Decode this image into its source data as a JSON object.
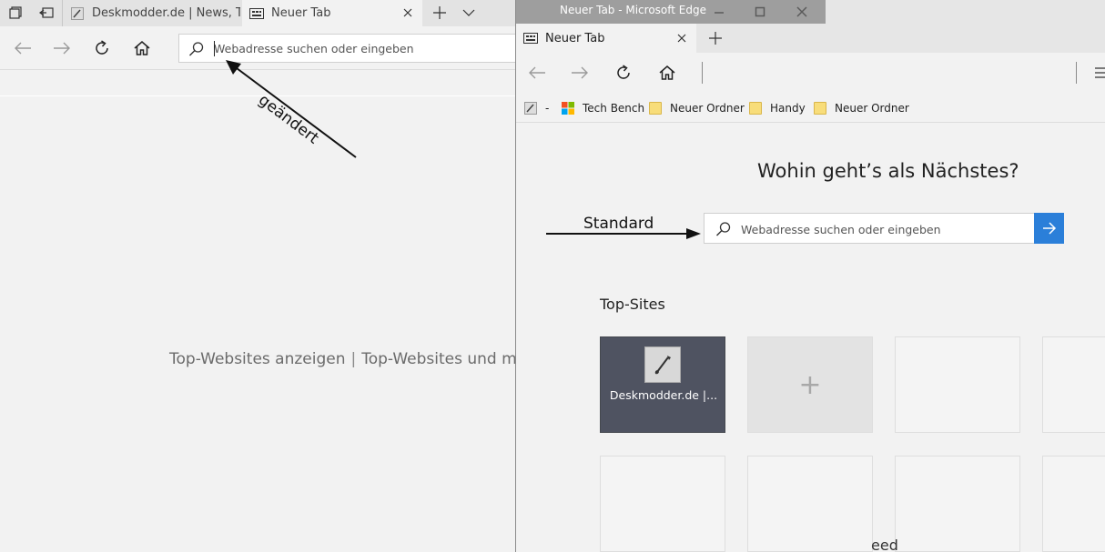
{
  "left_window": {
    "tabs": [
      {
        "label": "Deskmodder.de | News, Tipps"
      },
      {
        "label": "Neuer Tab"
      }
    ],
    "address": {
      "placeholder": "Webadresse suchen oder eingeben"
    },
    "top_sites": {
      "option1": "Top-Websites anzeigen",
      "separator": "|",
      "option2": "Top-Websites und me"
    },
    "annotation": "geändert"
  },
  "right_window": {
    "title": "Neuer Tab - Microsoft Edge",
    "tab": {
      "label": "Neuer Tab"
    },
    "favorites": [
      {
        "label": "-"
      },
      {
        "label": "Tech Bench"
      },
      {
        "label": "Neuer Ordner"
      },
      {
        "label": "Handy"
      },
      {
        "label": "Neuer Ordner"
      }
    ],
    "heading": "Wohin geht’s als Nächstes?",
    "search": {
      "placeholder": "Webadresse suchen oder eingeben"
    },
    "top_sites_heading": "Top-Sites",
    "tiles": [
      {
        "label": "Deskmodder.de |..."
      },
      {
        "label": "+"
      }
    ],
    "feed_partial": "eed",
    "annotation": "Standard"
  },
  "colors": {
    "accent_blue": "#2b7fd9",
    "tile_dark": "#4f5361",
    "page_bg": "#f2f2f2",
    "titlebar_gray": "#9e9e9e"
  }
}
